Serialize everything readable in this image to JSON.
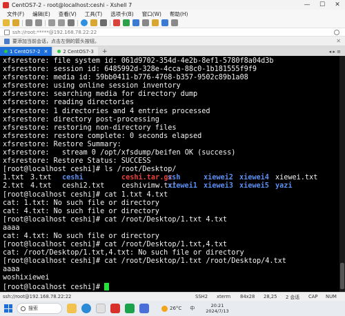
{
  "window": {
    "title": "CentOS7-2 - root@localhost:ceshi - Xshell 7",
    "controls": {
      "minimize": "—",
      "maximize": "☐",
      "close": "✕"
    }
  },
  "menu": [
    "文件(F)",
    "编辑(E)",
    "查看(V)",
    "工具(T)",
    "选项卡(B)",
    "窗口(W)",
    "帮助(H)"
  ],
  "address": {
    "text": "ssh://root:*****@192.168.78.22:22"
  },
  "hint": {
    "text": "要添加当前会话，点击左侧的箭头按钮。"
  },
  "tabs": [
    {
      "label": "1 CentOS7-2",
      "active": true,
      "dot_color": "#2ecc40"
    },
    {
      "label": "2 CentOS7-3",
      "active": false,
      "dot_color": "#2ecc40"
    }
  ],
  "terminal": {
    "prompt": "[root@localhost ceshi]# ",
    "lines": [
      "xfsrestore: file system id: 061d9702-354d-4e2b-8ef1-5780f8a04d3b",
      "xfsrestore: session id: 6485992d-328e-4cca-88c0-1b181555f9f9",
      "xfsrestore: media id: 59bb0411-b776-4768-b357-9502c89b1a08",
      "xfsrestore: using online session inventory",
      "xfsrestore: searching media for directory dump",
      "xfsrestore: reading directories",
      "xfsrestore: 1 directories and 4 entries processed",
      "xfsrestore: directory post-processing",
      "xfsrestore: restoring non-directory files",
      "xfsrestore: restore complete: 0 seconds elapsed",
      "xfsrestore: Restore Summary:",
      "xfsrestore:   stream 0 /opt/xfsdump/beifen OK (success)",
      "xfsrestore: Restore Status: SUCCESS",
      "[root@localhost ceshi]# ls /root/Desktop/"
    ],
    "ls_row1": [
      {
        "text": "1.txt",
        "kind": "file"
      },
      {
        "text": "3.txt",
        "kind": "file"
      },
      {
        "text": "ceshi",
        "kind": "dir"
      },
      {
        "text": "ceshi.tar.gz",
        "kind": "archive"
      },
      {
        "text": "ssh",
        "kind": "dir"
      },
      {
        "text": "xiewei2",
        "kind": "dir"
      },
      {
        "text": "xiewei4",
        "kind": "dir"
      },
      {
        "text": "xiewei.txt",
        "kind": "file"
      }
    ],
    "ls_row2": [
      {
        "text": "2.txt",
        "kind": "file"
      },
      {
        "text": "4.txt",
        "kind": "file"
      },
      {
        "text": "ceshi2.txt",
        "kind": "file"
      },
      {
        "text": "ceshivimw.txt",
        "kind": "file"
      },
      {
        "text": "xiewei1",
        "kind": "dir"
      },
      {
        "text": "xiewei3",
        "kind": "dir"
      },
      {
        "text": "xiewei5",
        "kind": "dir"
      },
      {
        "text": "yazi",
        "kind": "dir"
      }
    ],
    "lines_after": [
      "[root@localhost ceshi]# cat 1.txt 4.txt",
      "cat: 1.txt: No such file or directory",
      "cat: 4.txt: No such file or directory",
      "[root@localhost ceshi]# cat /root/Desktop/1.txt 4.txt",
      "aaaa",
      "cat: 4.txt: No such file or directory",
      "[root@localhost ceshi]# cat /root/Desktop/1.txt,4.txt",
      "cat: /root/Desktop/1.txt,4.txt: No such file or directory",
      "[root@localhost ceshi]# cat /root/Desktop/1.txt /root/Desktop/4.txt",
      "aaaa",
      "woshixiewei"
    ]
  },
  "status": {
    "connection": "ssh://root@192.168.78.22:22",
    "protocol": "SSH2",
    "terminal_type": "xterm",
    "size": "84x28",
    "cursor": "28,25",
    "sessions": "2 会话",
    "caps": "CAP",
    "num": "NUM"
  },
  "taskbar": {
    "search_label": "搜索",
    "weather": "26°C",
    "ime": "中",
    "time": "20:21",
    "date": "2024/7/13"
  },
  "colors": {
    "dir": "#5c8ff2",
    "archive": "#e8433a",
    "cursor": "#22e33a",
    "active_tab": "#1e6fd9"
  }
}
